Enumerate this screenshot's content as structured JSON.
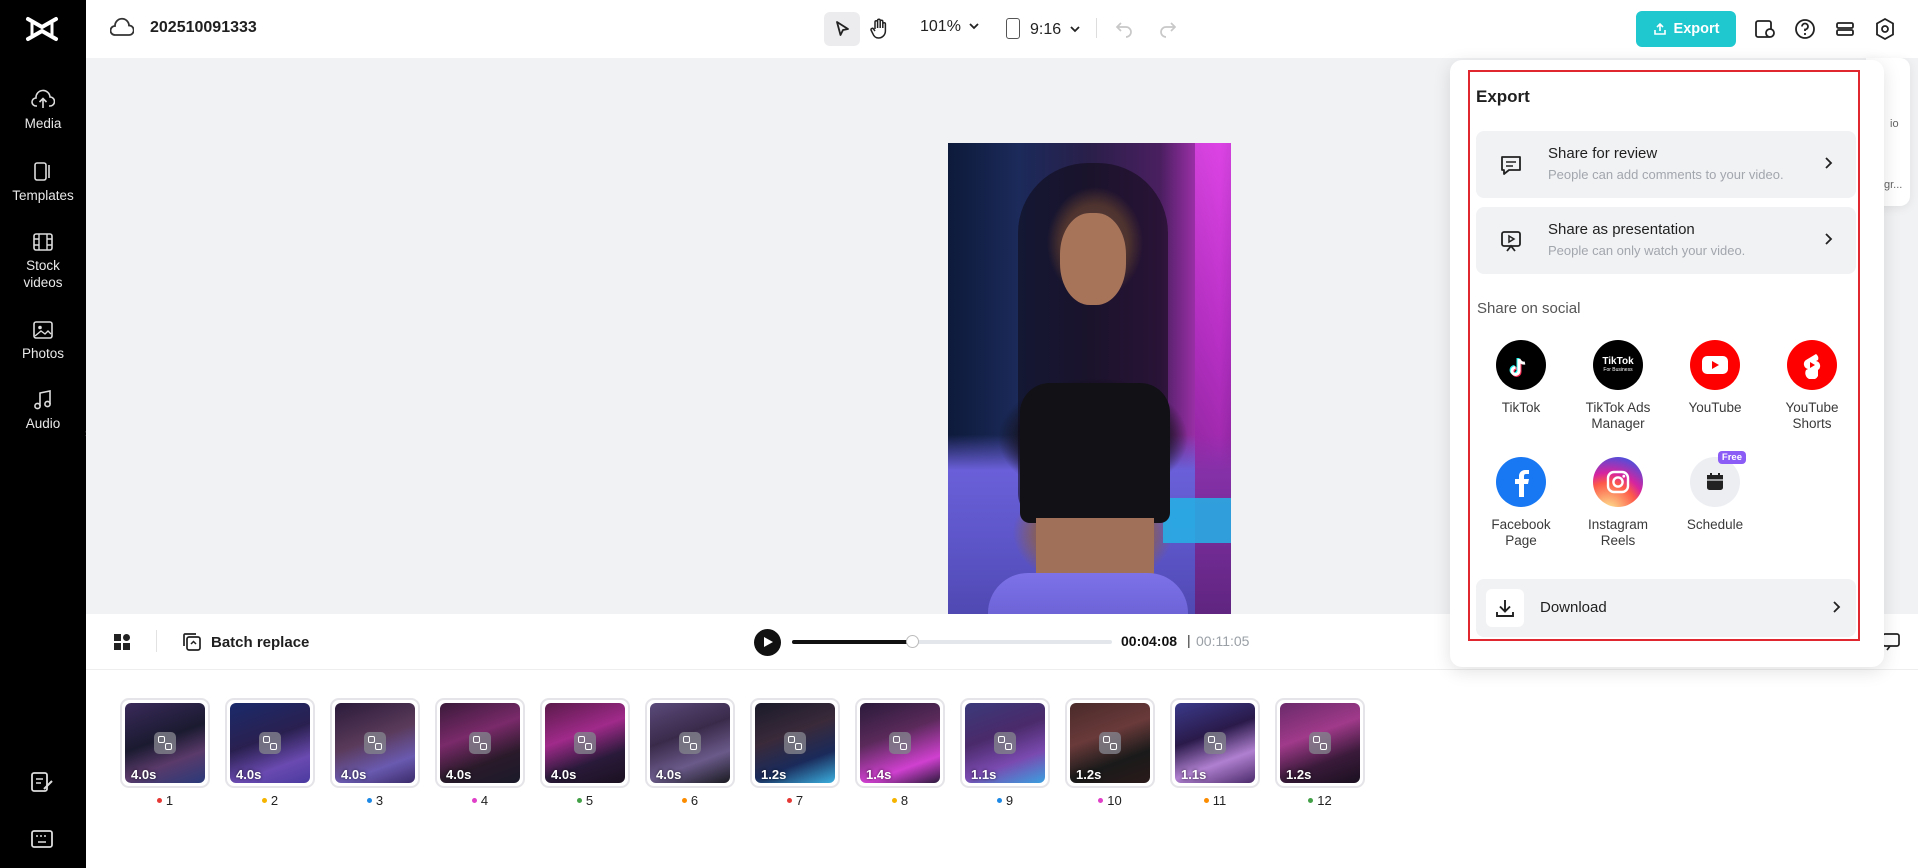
{
  "app": {
    "logo": "capcut-logo"
  },
  "sidebar": {
    "items": [
      {
        "label": "Media",
        "icon": "cloud-upload-icon"
      },
      {
        "label": "Templates",
        "icon": "templates-icon"
      },
      {
        "label": "Stock videos",
        "icon": "film-icon"
      },
      {
        "label": "Photos",
        "icon": "image-icon"
      },
      {
        "label": "Audio",
        "icon": "music-note-icon"
      }
    ],
    "bottom": [
      {
        "icon": "edit-notes-icon"
      },
      {
        "icon": "keyboard-icon"
      }
    ]
  },
  "topbar": {
    "project_title": "202510091333",
    "zoom": "101%",
    "ratio": "9:16",
    "export_label": "Export"
  },
  "playback": {
    "batch_replace": "Batch replace",
    "current_time": "00:04:08",
    "separator": "|",
    "total_time": "00:11:05",
    "progress": 0.375
  },
  "scenes": [
    {
      "num": "1",
      "dur": "4.0s",
      "dot": "#e53935"
    },
    {
      "num": "2",
      "dur": "4.0s",
      "dot": "#f5b400"
    },
    {
      "num": "3",
      "dur": "4.0s",
      "dot": "#1e88e5"
    },
    {
      "num": "4",
      "dur": "4.0s",
      "dot": "#e040c8"
    },
    {
      "num": "5",
      "dur": "4.0s",
      "dot": "#43a047"
    },
    {
      "num": "6",
      "dur": "4.0s",
      "dot": "#fb8c00"
    },
    {
      "num": "7",
      "dur": "1.2s",
      "dot": "#e53935"
    },
    {
      "num": "8",
      "dur": "1.4s",
      "dot": "#f5b400"
    },
    {
      "num": "9",
      "dur": "1.1s",
      "dot": "#1e88e5"
    },
    {
      "num": "10",
      "dur": "1.2s",
      "dot": "#e040c8"
    },
    {
      "num": "11",
      "dur": "1.1s",
      "dot": "#fb8c00"
    },
    {
      "num": "12",
      "dur": "1.2s",
      "dot": "#43a047"
    }
  ],
  "export_panel": {
    "title": "Export",
    "share_review": {
      "title": "Share for review",
      "subtitle": "People can add comments to your video."
    },
    "share_presentation": {
      "title": "Share as presentation",
      "subtitle": "People can only watch your video."
    },
    "social_label": "Share on social",
    "social": [
      {
        "label": "TikTok",
        "icon": "tiktok-icon",
        "color": "#000000"
      },
      {
        "label": "TikTok Ads Manager",
        "icon": "tiktok-business-icon",
        "color": "#000000",
        "logo_text": "TikTok",
        "logo_sub": "For Business"
      },
      {
        "label": "YouTube",
        "icon": "youtube-icon",
        "color": "#ff0000"
      },
      {
        "label": "YouTube Shorts",
        "icon": "youtube-shorts-icon",
        "color": "#ff0000"
      },
      {
        "label": "Facebook Page",
        "icon": "facebook-icon",
        "color": "#1877f2"
      },
      {
        "label": "Instagram Reels",
        "icon": "instagram-icon",
        "color": "#e1306c"
      },
      {
        "label": "Schedule",
        "icon": "calendar-icon",
        "color": "#eceef2",
        "badge": "Free"
      }
    ],
    "download_label": "Download"
  },
  "side_peek": {
    "label_1": "io",
    "label_2": "gr..."
  },
  "colors": {
    "accent": "#1fc7cf",
    "highlight_border": "#e0262e"
  }
}
